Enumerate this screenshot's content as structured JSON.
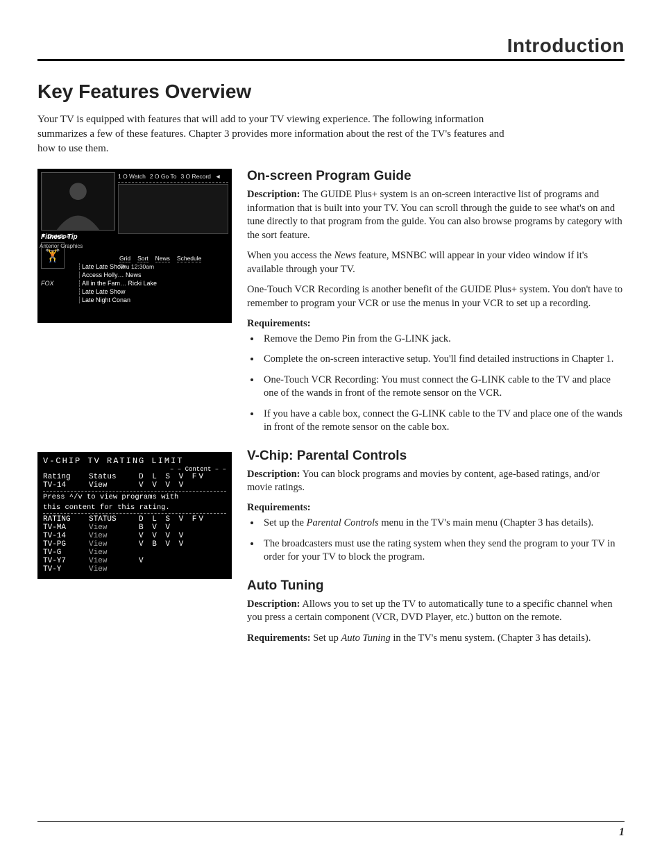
{
  "section_label": "Introduction",
  "page_title": "Key Features Overview",
  "intro": "Your TV is equipped with features that will add to your TV viewing experience. The following information summarizes a few of these features. Chapter 3 provides more information about the rest of the TV's features and how to use them.",
  "guide_mock": {
    "header_items": [
      "1 O Watch",
      "2 O Go To",
      "3 O Record"
    ],
    "tabs": [
      "Grid",
      "Sort",
      "News",
      "Schedule"
    ],
    "time": "Thu    12:30am",
    "video_label": "Dateline",
    "video_sublabel": "Anterior Graphics",
    "tip_label": "Fitness Tip",
    "rows": [
      {
        "ch": "",
        "prog": "Late Late Show"
      },
      {
        "ch": "",
        "prog": "Access Holly…    News"
      },
      {
        "ch": "FOX",
        "prog": "All in the Fam…  Ricki Lake"
      },
      {
        "ch": "",
        "prog": "Late Late Show"
      },
      {
        "ch": "",
        "prog": "Late Night Conan"
      }
    ]
  },
  "vchip_mock": {
    "title": "V-CHIP TV RATING LIMIT",
    "content_label": "– – Content – –",
    "header": {
      "rating": "Rating",
      "status": "Status",
      "flags": "D L S V FV"
    },
    "current": {
      "rating": "TV-14",
      "status": "View",
      "flags": "V V V V"
    },
    "msg1": "Press ^/v to view programs with",
    "msg2": "this content for this rating.",
    "header2": {
      "rating": "RATING",
      "status": "STATUS",
      "flags": "D L S V FV"
    },
    "rows": [
      {
        "rating": "TV-MA",
        "status": "View",
        "flags": "  B V V"
      },
      {
        "rating": "TV-14",
        "status": "View",
        "flags": "V V V V"
      },
      {
        "rating": "TV-PG",
        "status": "View",
        "flags": "V B V V"
      },
      {
        "rating": "TV-G",
        "status": "View",
        "flags": ""
      },
      {
        "rating": "TV-Y7",
        "status": "View",
        "flags": "        V"
      },
      {
        "rating": "TV-Y",
        "status": "View",
        "flags": ""
      }
    ]
  },
  "features": {
    "guide": {
      "heading": "On-screen Program Guide",
      "desc_label": "Description:",
      "desc1": "The GUIDE Plus+ system is an on-screen interactive list of programs and information that is built into your TV. You can scroll through the guide to see what's on and tune directly to that program from the guide. You can also browse programs by category with the sort feature.",
      "desc2_pre": "When you access the ",
      "desc2_ital": "News",
      "desc2_post": " feature, MSNBC will appear in your video window if it's available through your TV.",
      "desc3": "One-Touch VCR Recording is another benefit of the GUIDE Plus+ system. You don't have to remember to program your VCR or use the menus in your VCR to set up a recording.",
      "req_label": "Requirements:",
      "reqs": [
        "Remove the Demo Pin from the G-LINK jack.",
        "Complete the on-screen interactive setup. You'll find detailed instructions in Chapter 1.",
        "One-Touch VCR Recording: You must connect the G-LINK cable to the TV and place one of the wands in front of the remote sensor on the VCR.",
        "If you have a cable box, connect the G-LINK cable to the TV and place one of the wands in front of the remote sensor on the cable box."
      ]
    },
    "vchip": {
      "heading": "V-Chip: Parental Controls",
      "desc_label": "Description:",
      "desc": "You can block programs and movies by content, age-based ratings, and/or movie ratings.",
      "req_label": "Requirements:",
      "reqs_pre1": "Set up the ",
      "reqs_ital1": "Parental Controls",
      "reqs_post1": " menu in the TV's main menu (Chapter 3 has details).",
      "req2": "The broadcasters must use the rating system when they send the program to your TV in order for your TV to block the program."
    },
    "auto": {
      "heading": "Auto Tuning",
      "desc_label": "Description:",
      "desc": "Allows you to set up the TV to automatically tune to a specific channel when you press a certain component (VCR, DVD Player, etc.) button on the remote.",
      "req_label": "Requirements:",
      "req_pre": " Set up ",
      "req_ital": "Auto Tuning",
      "req_post": " in the TV's menu system. (Chapter 3 has details)."
    }
  },
  "page_number": "1"
}
